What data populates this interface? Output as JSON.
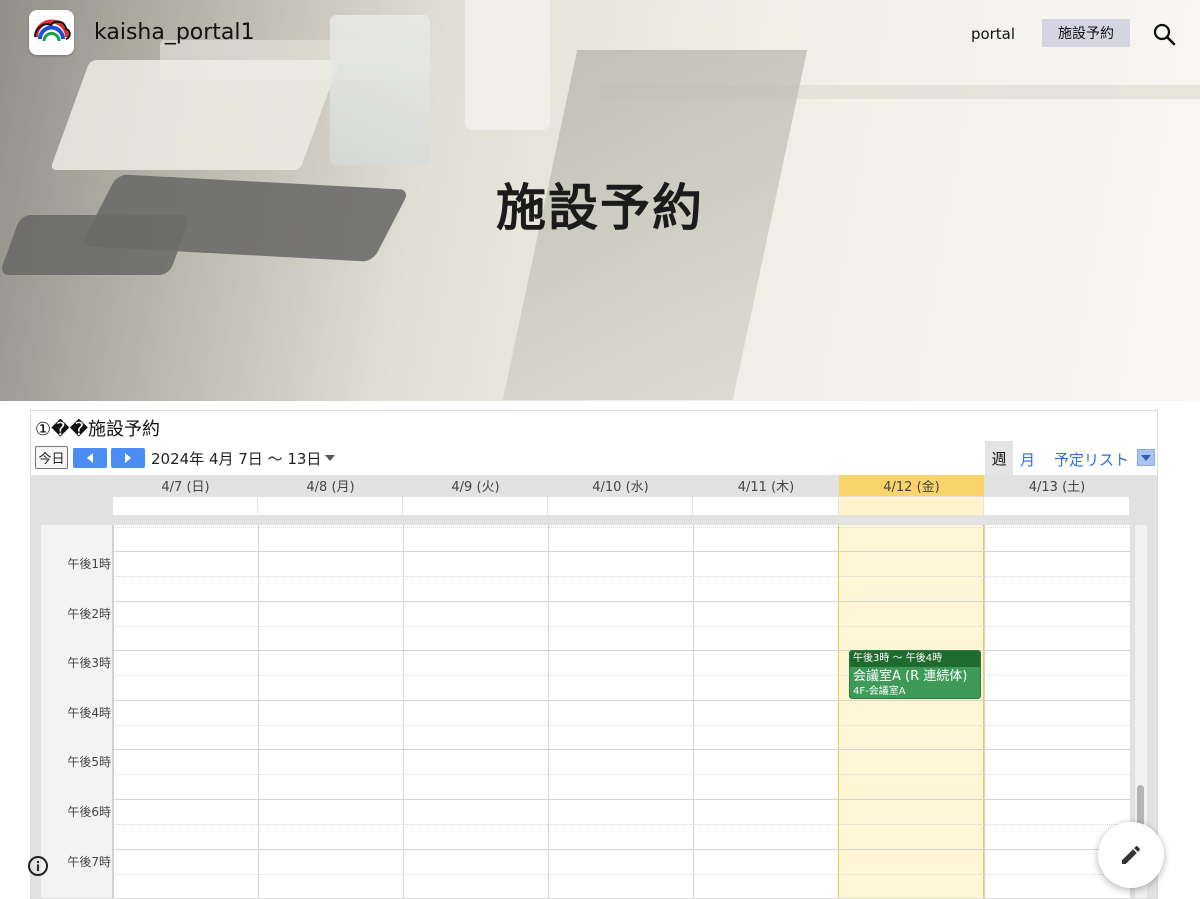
{
  "header": {
    "site_title": "kaisha_portal1",
    "nav": [
      {
        "label": "portal",
        "active": false
      },
      {
        "label": "施設予約",
        "active": true
      }
    ],
    "search_icon": "search-icon",
    "hero_title": "施設予約"
  },
  "widget": {
    "title": "①��施設予約",
    "today_label": "今日",
    "prev_icon": "chevron-left-icon",
    "next_icon": "chevron-right-icon",
    "date_range": "2024年 4月 7日 〜 13日",
    "views": {
      "week": "週",
      "month": "月",
      "list": "予定リスト"
    },
    "days": [
      {
        "label": "4/7 (日)",
        "today": false
      },
      {
        "label": "4/8 (月)",
        "today": false
      },
      {
        "label": "4/9 (火)",
        "today": false
      },
      {
        "label": "4/10 (水)",
        "today": false
      },
      {
        "label": "4/11 (木)",
        "today": false
      },
      {
        "label": "4/12 (金)",
        "today": true
      },
      {
        "label": "4/13 (土)",
        "today": false
      }
    ],
    "hours": [
      "午後1時",
      "午後2時",
      "午後3時",
      "午後4時",
      "午後5時",
      "午後6時",
      "午後7時"
    ],
    "event": {
      "time": "午後3時 〜 午後4時",
      "title": "会議室A (R 連続体)",
      "location": "4F-会議室A",
      "day": "4/12 (金)"
    },
    "today_color": "#f9d46b",
    "event_color": "#3d9b57"
  },
  "footer": {
    "info_icon": "info-icon",
    "edit_icon": "pencil-icon"
  }
}
